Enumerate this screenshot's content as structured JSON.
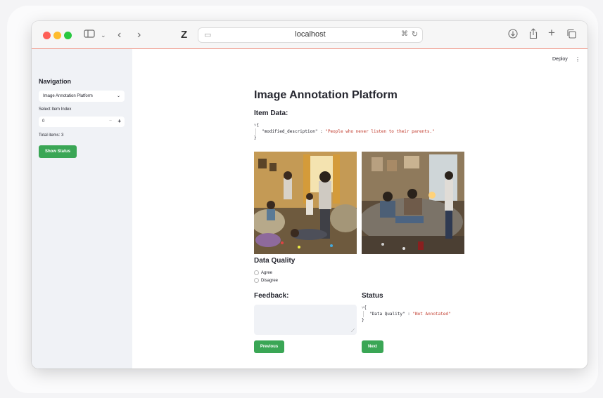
{
  "browser": {
    "url": "localhost",
    "toolbar_icons": [
      "sidebar-icon",
      "chevron-down-icon",
      "back-icon",
      "forward-icon",
      "zotero-icon",
      "download-icon",
      "share-icon",
      "new-tab-icon",
      "tabs-icon"
    ]
  },
  "app": {
    "deploy_label": "Deploy",
    "menu_glyph": "⋮"
  },
  "sidebar": {
    "title": "Navigation",
    "page_select_value": "Image Annotation Platform",
    "index_label": "Select Item Index",
    "index_value": "0",
    "minus": "−",
    "plus": "+",
    "total_items": "Total items: 3",
    "show_status_label": "Show Status"
  },
  "main": {
    "title": "Image Annotation Platform",
    "item_data_heading": "Item Data:",
    "item_data": {
      "key": "\"modified_description\"",
      "value": "\"People who never listen to their parents.\""
    },
    "data_quality_heading": "Data Quality",
    "options": [
      "Agree",
      "Disagree"
    ],
    "feedback_heading": "Feedback:",
    "status_heading": "Status",
    "status": {
      "key": "\"Data Quality\"",
      "value": "\"Not Annotated\""
    },
    "previous_label": "Previous",
    "next_label": "Next"
  },
  "colors": {
    "accent_green": "#3aa655",
    "json_string": "#c0392b",
    "sidebar_bg": "#f0f2f6"
  }
}
